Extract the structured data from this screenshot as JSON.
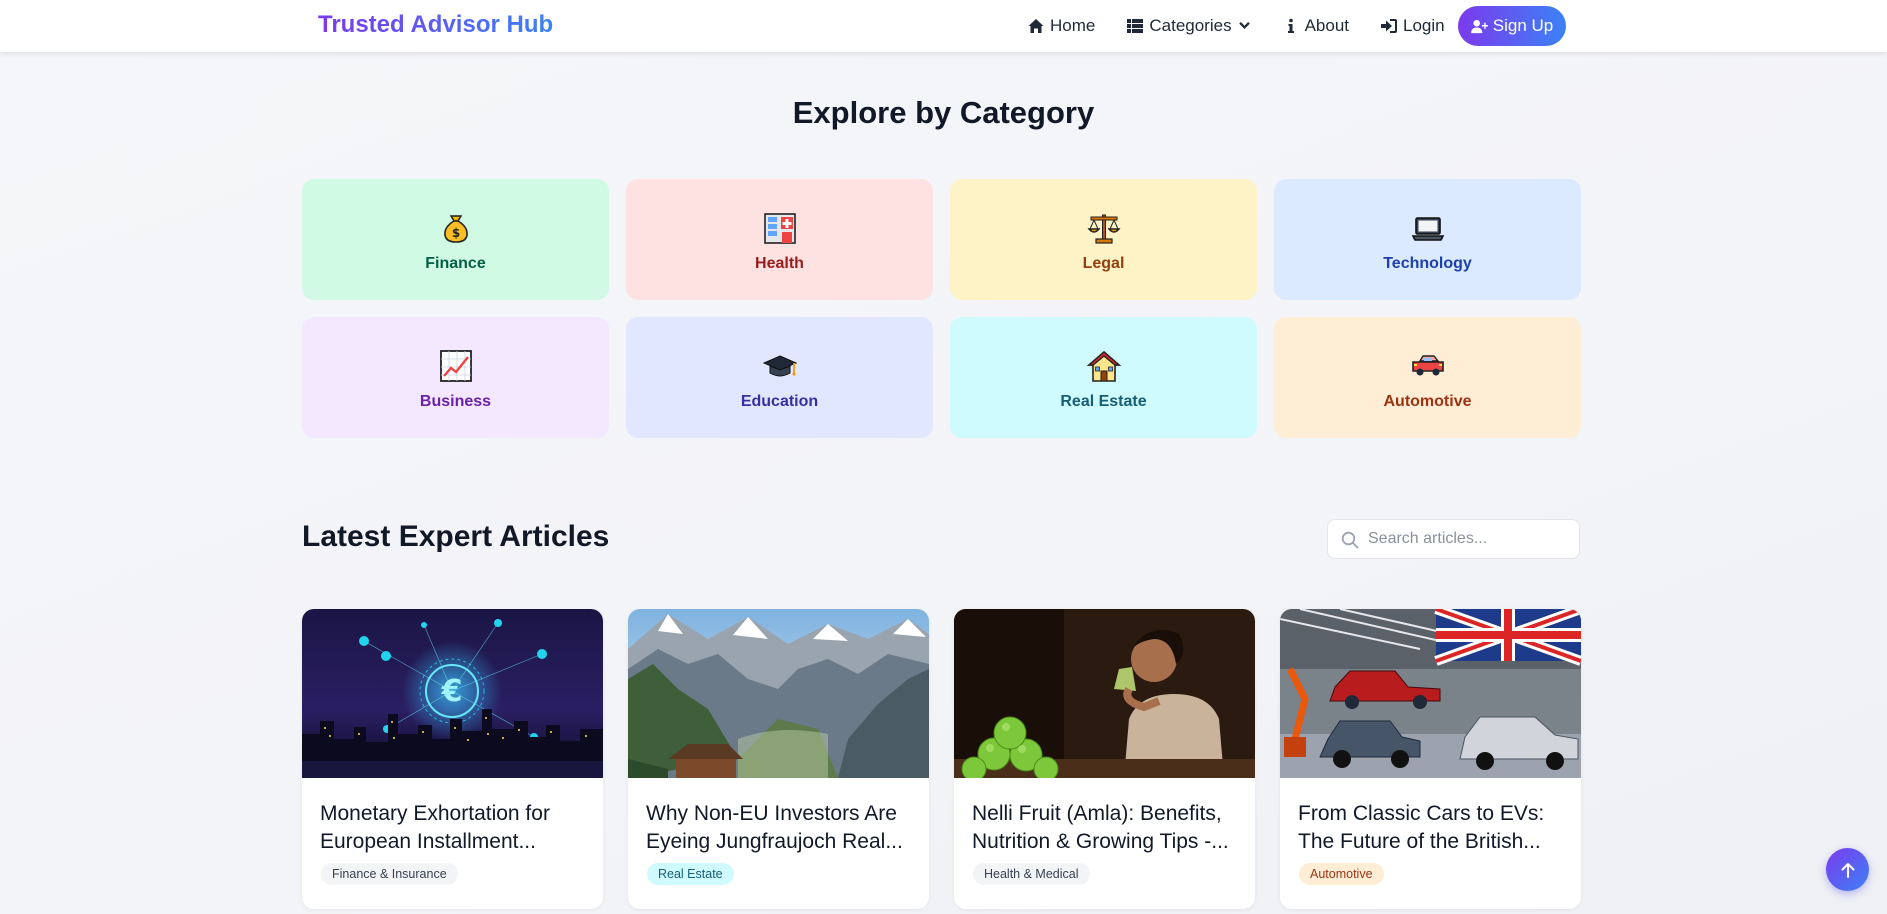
{
  "nav": {
    "brand": "Trusted Advisor Hub",
    "links": [
      {
        "label": "Home",
        "icon": "home-icon"
      },
      {
        "label": "Categories",
        "icon": "grid-icon"
      },
      {
        "label": "About",
        "icon": "info-icon"
      },
      {
        "label": "Login",
        "icon": "login-icon"
      }
    ],
    "signup": "Sign Up"
  },
  "categories": {
    "title": "Explore by Category",
    "items": [
      {
        "label": "Finance",
        "icon": "money-bag-icon",
        "bg": "#d1fae5",
        "color": "#065f46"
      },
      {
        "label": "Health",
        "icon": "hospital-icon",
        "bg": "#fee2e2",
        "color": "#991b1b"
      },
      {
        "label": "Legal",
        "icon": "scales-icon",
        "bg": "#fef3c7",
        "color": "#92400e"
      },
      {
        "label": "Technology",
        "icon": "laptop-icon",
        "bg": "#dbeafe",
        "color": "#1e40af"
      },
      {
        "label": "Business",
        "icon": "chart-increasing-icon",
        "bg": "#f3e8ff",
        "color": "#6b21a8"
      },
      {
        "label": "Education",
        "icon": "graduation-cap-icon",
        "bg": "#e0e7ff",
        "color": "#3730a3"
      },
      {
        "label": "Real Estate",
        "icon": "house-icon",
        "bg": "#cffafe",
        "color": "#155e75"
      },
      {
        "label": "Automotive",
        "icon": "car-icon",
        "bg": "#ffedd5",
        "color": "#9a3412"
      }
    ]
  },
  "latest": {
    "title": "Latest Expert Articles",
    "search_placeholder": "Search articles..."
  },
  "articles": [
    {
      "title": "Monetary Exhortation for European Installment...",
      "category": "Finance & Insurance",
      "badge_bg": "#f3f4f6",
      "badge_color": "#374151"
    },
    {
      "title": "Why Non-EU Investors Are Eyeing Jungfraujoch Real...",
      "category": "Real Estate",
      "badge_bg": "#cffafe",
      "badge_color": "#155e75"
    },
    {
      "title": "Nelli Fruit (Amla): Benefits, Nutrition & Growing Tips -...",
      "category": "Health & Medical",
      "badge_bg": "#f3f4f6",
      "badge_color": "#374151"
    },
    {
      "title": "From Classic Cars to EVs: The Future of the British...",
      "category": "Automotive",
      "badge_bg": "#ffedd5",
      "badge_color": "#9a3412"
    }
  ]
}
